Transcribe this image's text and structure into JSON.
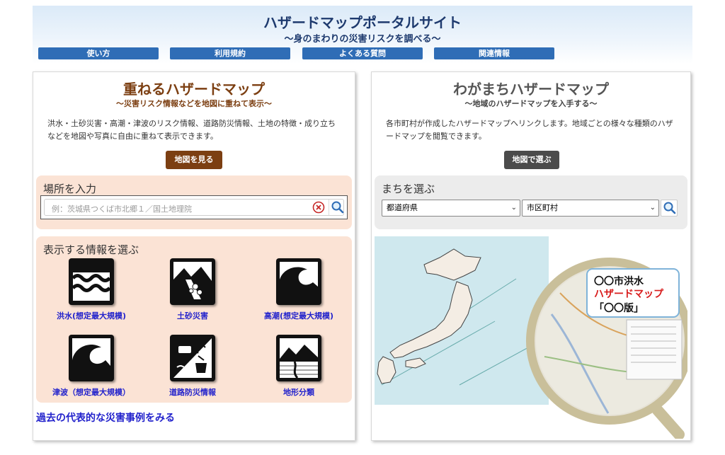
{
  "header": {
    "title": "ハザードマップポータルサイト",
    "subtitle": "〜身のまわりの災害リスクを調べる〜",
    "nav": [
      "使い方",
      "利用規約",
      "よくある質問",
      "関連情報"
    ]
  },
  "left": {
    "title": "重ねるハザードマップ",
    "subtitle": "〜災害リスク情報などを地図に重ねて表示〜",
    "description": "洪水・土砂災害・高潮・津波のリスク情報、道路防災情報、土地の特徴・成り立ちなどを地図や写真に自由に重ねて表示できます。",
    "button": "地図を見る",
    "place_section": {
      "heading": "場所を入力",
      "placeholder": "例：茨城県つくば市北郷１／国土地理院"
    },
    "info_section": {
      "heading": "表示する情報を選ぶ",
      "items": [
        {
          "label": "洪水(想定最大規模)",
          "icon": "flood-icon"
        },
        {
          "label": "土砂災害",
          "icon": "landslide-icon"
        },
        {
          "label": "高潮(想定最大規模)",
          "icon": "storm-surge-icon"
        },
        {
          "label": "津波（想定最大規模）",
          "icon": "tsunami-icon"
        },
        {
          "label": "道路防災情報",
          "icon": "road-disaster-icon"
        },
        {
          "label": "地形分類",
          "icon": "landform-icon"
        }
      ]
    },
    "past_cases_link": "過去の代表的な災害事例をみる"
  },
  "right": {
    "title": "わがまちハザードマップ",
    "subtitle": "〜地域のハザードマップを入手する〜",
    "description": "各市町村が作成したハザードマップへリンクします。地域ごとの様々な種類のハザードマップを閲覧できます。",
    "button": "地図で選ぶ",
    "town_section": {
      "heading": "まちを選ぶ",
      "prefecture_select": "都道府県",
      "city_select": "市区町村"
    },
    "map_callout": [
      "〇〇市洪水",
      "ハザードマップ",
      "「〇〇版」"
    ]
  },
  "colors": {
    "header_blue": "#2f6db6",
    "brown_accent": "#7c3f12",
    "link_blue": "#2222cc",
    "peach_section": "#fbe3d5",
    "gray_section": "#ececec"
  }
}
